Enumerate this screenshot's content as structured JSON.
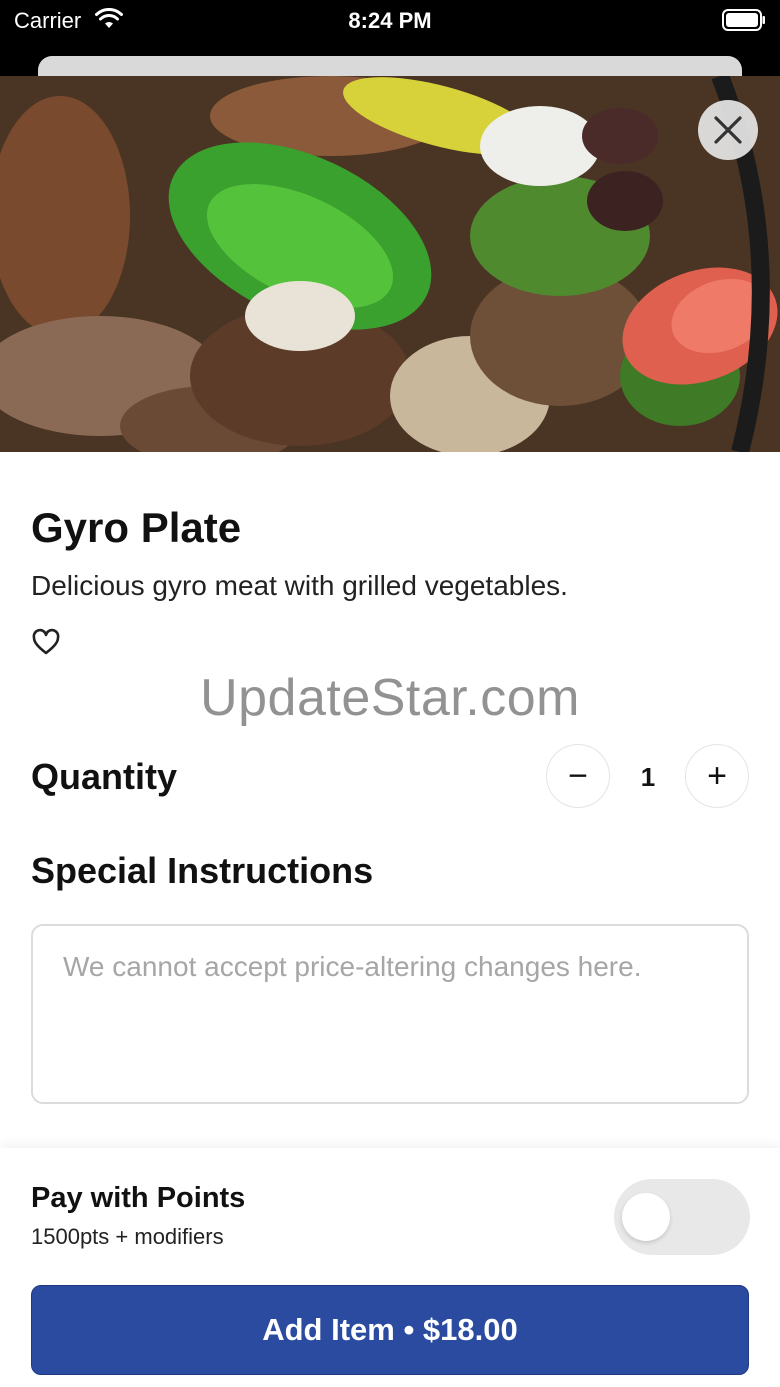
{
  "status_bar": {
    "carrier": "Carrier",
    "time": "8:24 PM",
    "icons": [
      "wifi-icon",
      "battery-icon"
    ]
  },
  "item": {
    "title": "Gyro Plate",
    "description": "Delicious gyro meat with grilled vegetables.",
    "image_icon": "food-photo",
    "favorite_icon": "heart-icon",
    "close_icon": "close-icon"
  },
  "watermark": "UpdateStar.com",
  "quantity": {
    "label": "Quantity",
    "value": "1",
    "minus": "−",
    "plus": "+"
  },
  "special_instructions": {
    "label": "Special Instructions",
    "placeholder": "We cannot accept price-altering changes here.",
    "value": ""
  },
  "pay_with_points": {
    "title": "Pay with Points",
    "subtitle": "1500pts + modifiers",
    "enabled": false
  },
  "add_button": {
    "label": "Add Item • $18.00"
  },
  "colors": {
    "primary": "#2b4ba1",
    "toggle_off": "#e8e8e8"
  }
}
